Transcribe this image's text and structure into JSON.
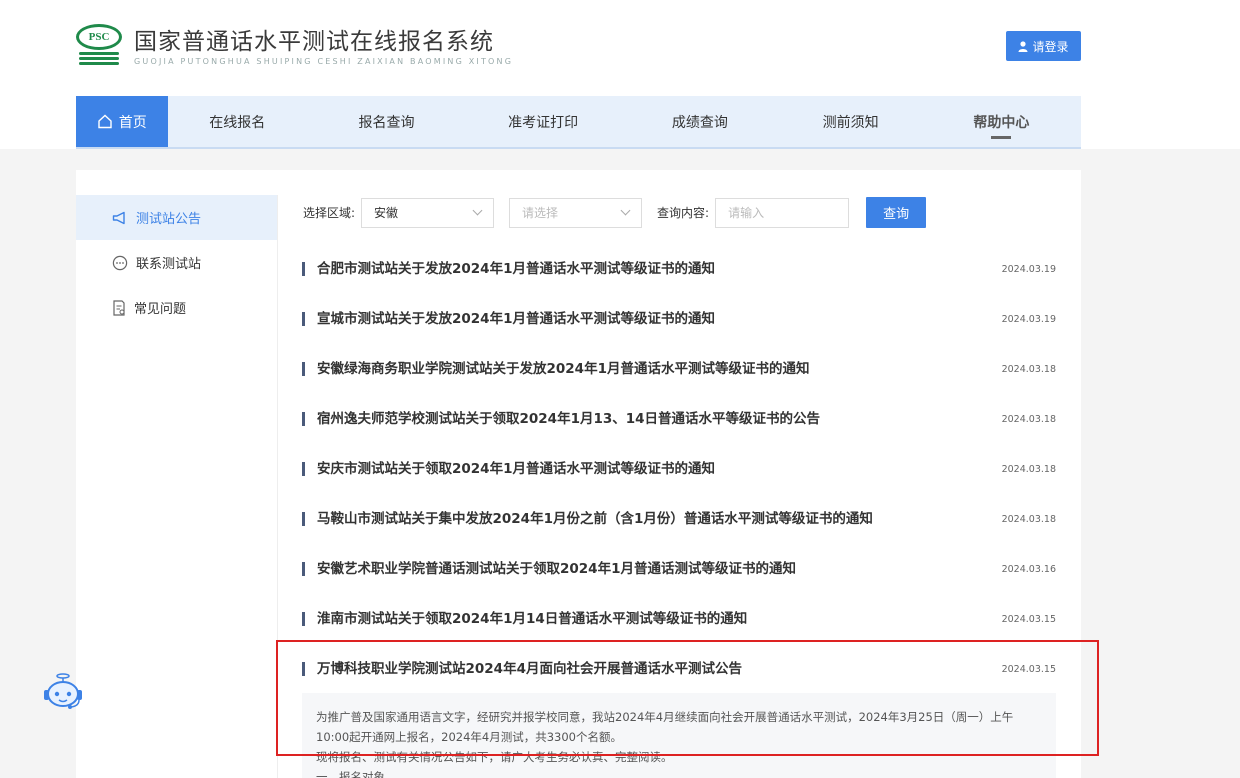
{
  "header": {
    "logo_mark": "PSC",
    "title": "国家普通话水平测试在线报名系统",
    "subtitle": "GUOJIA PUTONGHUA SHUIPING CESHI ZAIXIAN BAOMING XITONG",
    "login_label": "请登录"
  },
  "nav": {
    "items": [
      {
        "label": "首页"
      },
      {
        "label": "在线报名"
      },
      {
        "label": "报名查询"
      },
      {
        "label": "准考证打印"
      },
      {
        "label": "成绩查询"
      },
      {
        "label": "测前须知"
      },
      {
        "label": "帮助中心"
      }
    ]
  },
  "sidebar": {
    "items": [
      {
        "label": "测试站公告",
        "icon": "megaphone-icon"
      },
      {
        "label": "联系测试站",
        "icon": "chat-icon"
      },
      {
        "label": "常见问题",
        "icon": "document-icon"
      }
    ]
  },
  "filter": {
    "region_label": "选择区域:",
    "region_value": "安徽",
    "second_placeholder": "请选择",
    "query_label": "查询内容:",
    "query_placeholder": "请输入",
    "query_button": "查询"
  },
  "news": [
    {
      "title": "合肥市测试站关于发放2024年1月普通话水平测试等级证书的通知",
      "date": "2024.03.19"
    },
    {
      "title": "宣城市测试站关于发放2024年1月普通话水平测试等级证书的通知",
      "date": "2024.03.19"
    },
    {
      "title": "安徽绿海商务职业学院测试站关于发放2024年1月普通话水平测试等级证书的通知",
      "date": "2024.03.18"
    },
    {
      "title": "宿州逸夫师范学校测试站关于领取2024年1月13、14日普通话水平等级证书的公告",
      "date": "2024.03.18"
    },
    {
      "title": "安庆市测试站关于领取2024年1月普通话水平测试等级证书的通知",
      "date": "2024.03.18"
    },
    {
      "title": "马鞍山市测试站关于集中发放2024年1月份之前（含1月份）普通话水平测试等级证书的通知",
      "date": "2024.03.18"
    },
    {
      "title": "安徽艺术职业学院普通话测试站关于领取2024年1月普通话测试等级证书的通知",
      "date": "2024.03.16"
    },
    {
      "title": "淮南市测试站关于领取2024年1月14日普通话水平测试等级证书的通知",
      "date": "2024.03.15"
    },
    {
      "title": "万博科技职业学院测试站2024年4月面向社会开展普通话水平测试公告",
      "date": "2024.03.15"
    }
  ],
  "excerpt": {
    "line1": "为推广普及国家通用语言文字，经研究并报学校同意，我站2024年4月继续面向社会开展普通话水平测试，2024年3月25日（周一）上午",
    "line2": "10:00起开通网上报名，2024年4月测试，共3300个名额。",
    "line3": "现将报名、测试有关情况公告如下，请广大考生务必认真、完整阅读。",
    "line4": "一、报名对象"
  },
  "colors": {
    "accent": "#3d82e6",
    "nav_bg": "#e7f0fb",
    "logo_green": "#1f8a4a",
    "highlight": "#dd2222"
  }
}
